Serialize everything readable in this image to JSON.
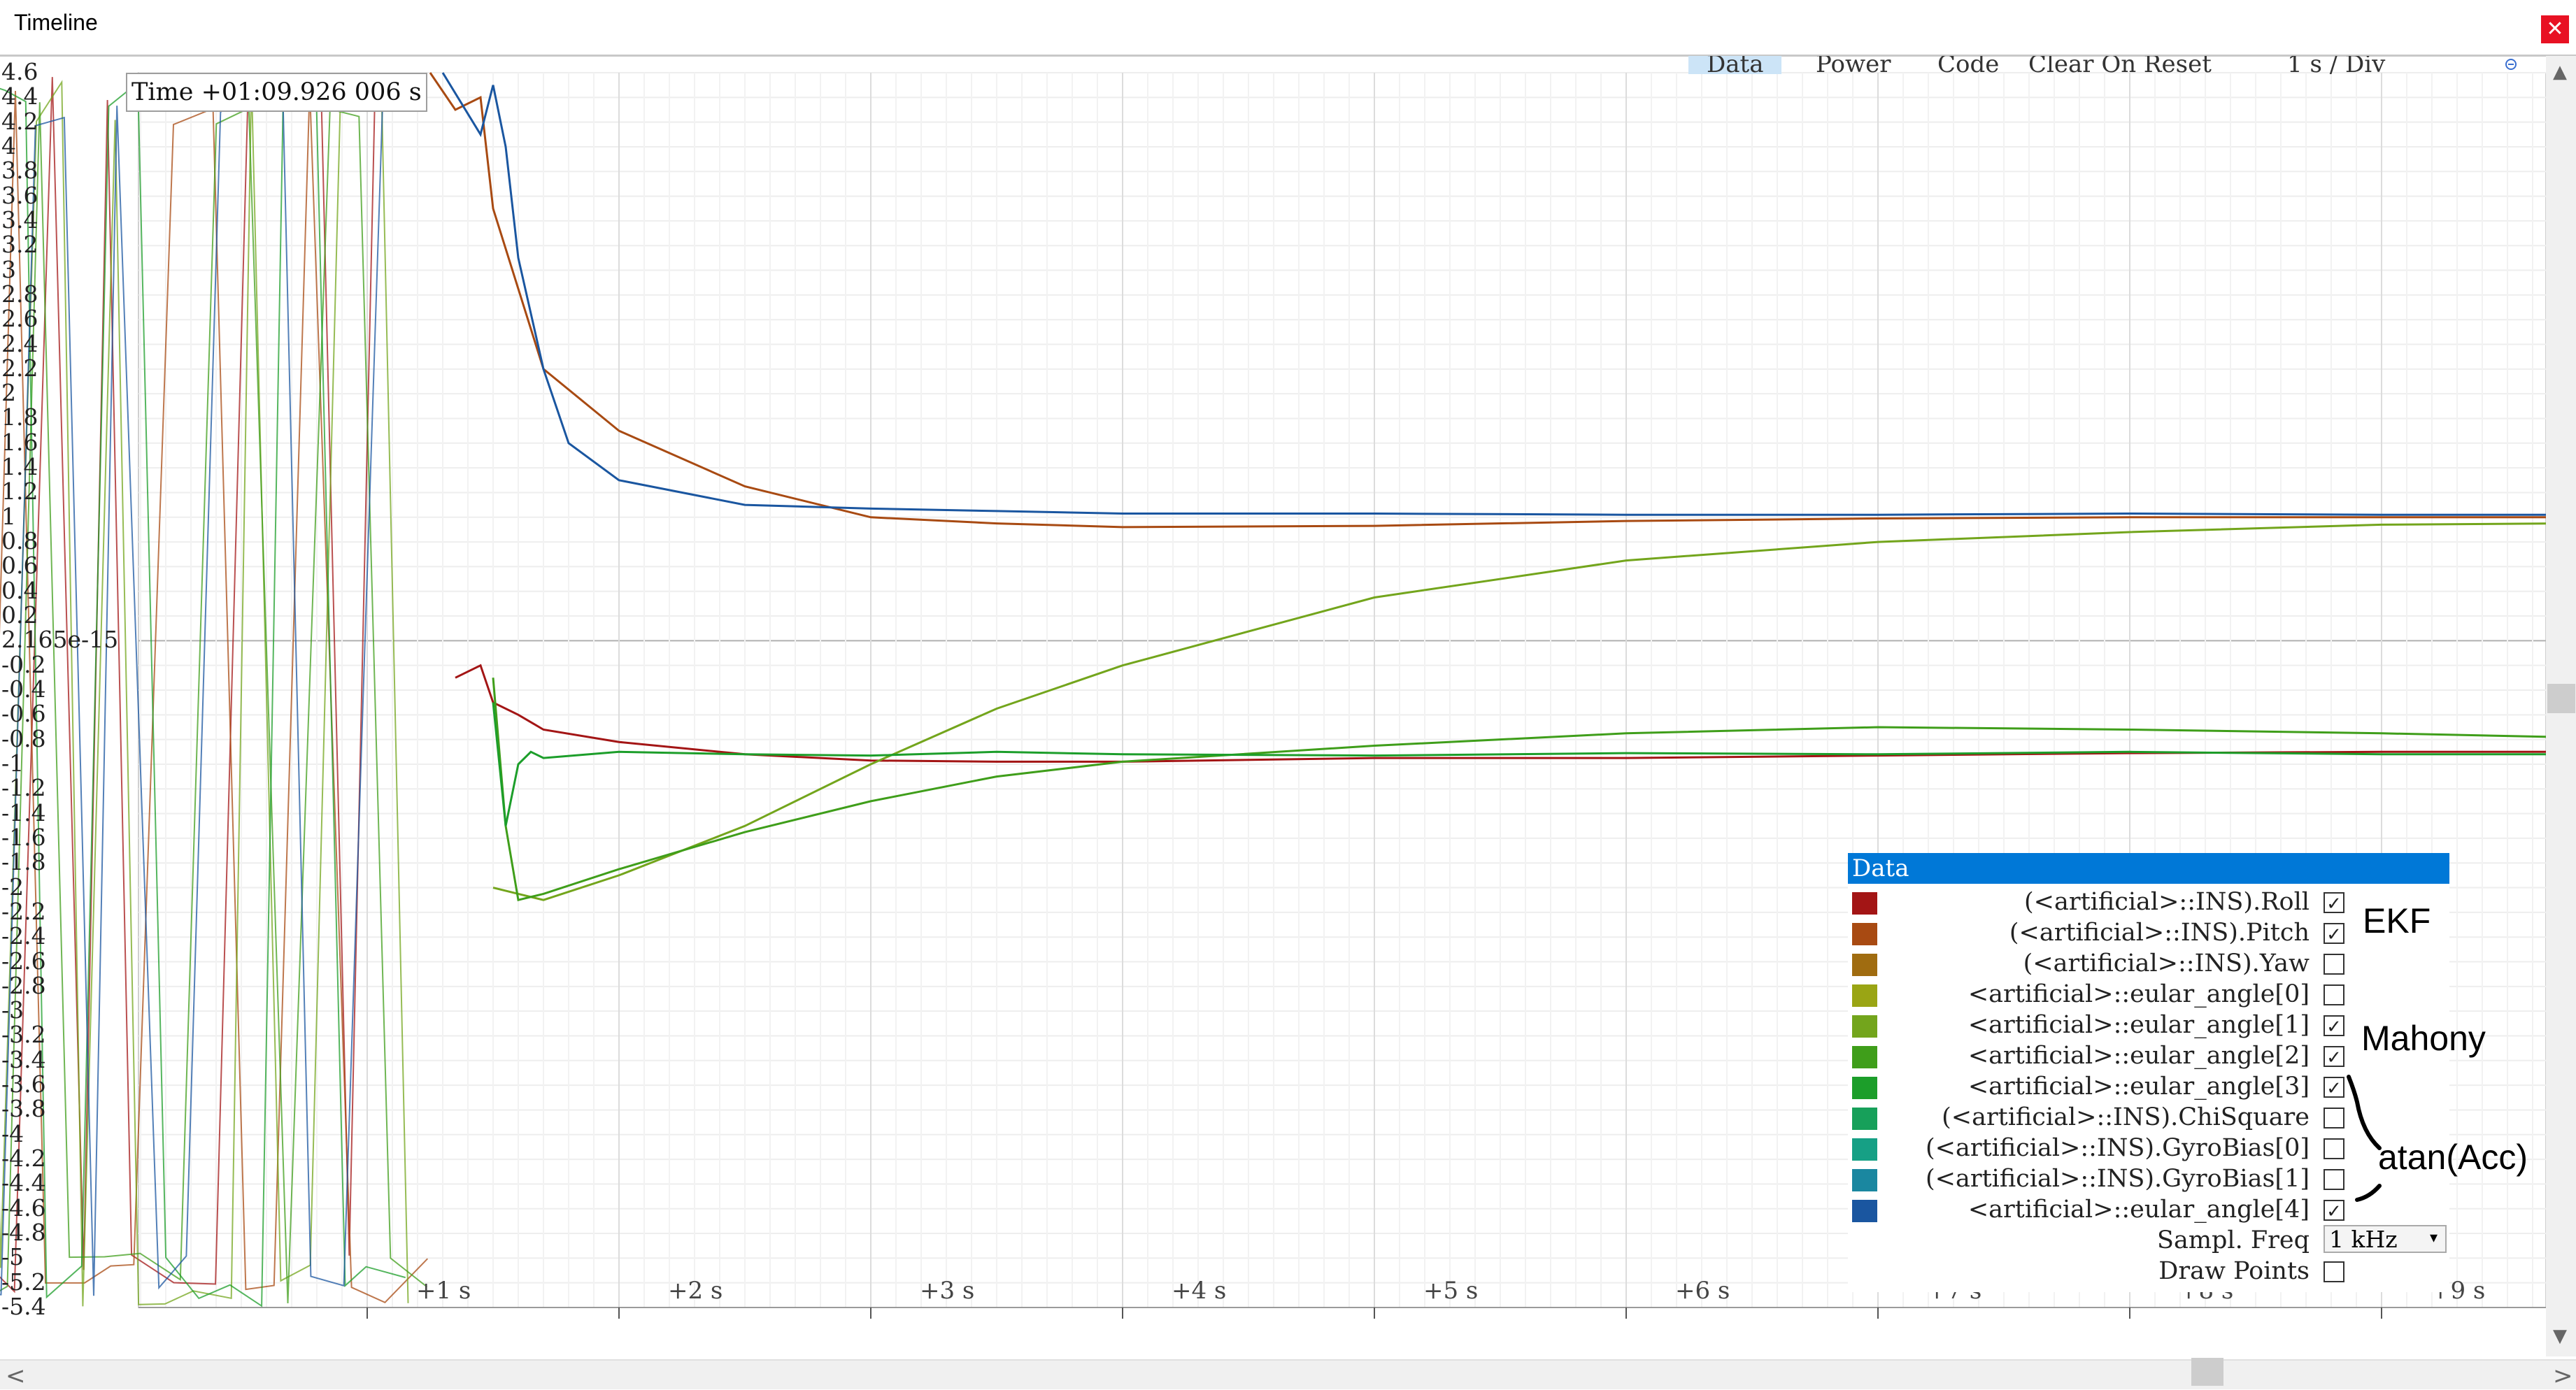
{
  "window": {
    "title": "Timeline",
    "close_glyph": "✕"
  },
  "toolbar": {
    "tabs": [
      {
        "label": "Data",
        "active": true
      },
      {
        "label": "Power",
        "active": false
      },
      {
        "label": "Code",
        "active": false
      }
    ],
    "reset_select": {
      "selected": "Clear On Reset",
      "arrow": "▾"
    },
    "timebase_select": {
      "selected": "1 s / Div",
      "arrow": "▾"
    },
    "zoom_out_icon": "zoom-out-icon",
    "zoom_in_icon": "zoom-in-icon"
  },
  "time_readout": "Time +01:09.926 006 s",
  "y_ticks": [
    "4.6",
    "4.4",
    "4.2",
    "4",
    "3.8",
    "3.6",
    "3.4",
    "3.2",
    "3",
    "2.8",
    "2.6",
    "2.4",
    "2.2",
    "2",
    "1.8",
    "1.6",
    "1.4",
    "1.2",
    "1",
    "0.8",
    "0.6",
    "0.4",
    "0.2",
    "2.165e-15",
    "-0.2",
    "-0.4",
    "-0.6",
    "-0.8",
    "-1",
    "-1.2",
    "-1.4",
    "-1.6",
    "-1.8",
    "-2",
    "-2.2",
    "-2.4",
    "-2.6",
    "-2.8",
    "-3",
    "-3.2",
    "-3.4",
    "-3.6",
    "-3.8",
    "-4",
    "-4.2",
    "-4.4",
    "-4.6",
    "-4.8",
    "-5",
    "-5.2",
    "-5.4"
  ],
  "x_ticks": [
    "+1 s",
    "+2 s",
    "+3 s",
    "+4 s",
    "+5 s",
    "+6 s",
    "+7 s",
    "+8 s",
    "+9 s"
  ],
  "legend": {
    "header": "Data",
    "items": [
      {
        "label": "(<artificial>::INS).Roll",
        "color": "#a31515",
        "checked": true
      },
      {
        "label": "(<artificial>::INS).Pitch",
        "color": "#a84a12",
        "checked": true
      },
      {
        "label": "(<artificial>::INS).Yaw",
        "color": "#a06c10",
        "checked": false
      },
      {
        "label": "<artificial>::eular_angle[0]",
        "color": "#9aa514",
        "checked": false
      },
      {
        "label": "<artificial>::eular_angle[1]",
        "color": "#73a51c",
        "checked": true
      },
      {
        "label": "<artificial>::eular_angle[2]",
        "color": "#3f9e1a",
        "checked": true
      },
      {
        "label": "<artificial>::eular_angle[3]",
        "color": "#1c9e2a",
        "checked": true
      },
      {
        "label": "(<artificial>::INS).ChiSquare",
        "color": "#17a05a",
        "checked": false
      },
      {
        "label": "(<artificial>::INS).GyroBias[0]",
        "color": "#16a085",
        "checked": false
      },
      {
        "label": "(<artificial>::INS).GyroBias[1]",
        "color": "#1a87a0",
        "checked": false
      },
      {
        "label": "<artificial>::eular_angle[4]",
        "color": "#1a56a0",
        "checked": true
      }
    ],
    "check_glyph": "✓",
    "sample_freq_label": "Sampl. Freq",
    "sample_freq_value": "1 kHz",
    "select_arrow": "▾",
    "draw_points_label": "Draw Points",
    "draw_points_checked": false
  },
  "annotations": [
    "EKF",
    "Mahony",
    "atan(Acc)"
  ],
  "scrollbar_arrows": {
    "left": "<",
    "right": ">",
    "up": "▲",
    "down": "▼"
  },
  "chart_data": {
    "type": "line",
    "xlabel": "",
    "ylabel": "",
    "xlim": [
      -0.85,
      9.7
    ],
    "ylim": [
      -5.4,
      4.6
    ],
    "grid": true,
    "legend_position": "bottom-right",
    "series": [
      {
        "name": "(<artificial>::INS).Roll",
        "color": "#a31515",
        "x": [
          1.35,
          1.45,
          1.5,
          1.6,
          1.7,
          2.0,
          2.5,
          3.0,
          3.5,
          4.0,
          5.0,
          6.0,
          7.0,
          8.0,
          9.0,
          9.7
        ],
        "y": [
          -0.3,
          -0.2,
          -0.5,
          -0.6,
          -0.72,
          -0.82,
          -0.92,
          -0.97,
          -0.98,
          -0.98,
          -0.95,
          -0.95,
          -0.93,
          -0.91,
          -0.9,
          -0.9
        ]
      },
      {
        "name": "(<artificial>::INS).Pitch",
        "color": "#a84a12",
        "x": [
          1.25,
          1.35,
          1.45,
          1.5,
          1.7,
          2.0,
          2.5,
          3.0,
          3.5,
          4.0,
          5.0,
          6.0,
          7.0,
          8.0,
          9.0,
          9.7
        ],
        "y": [
          4.6,
          4.3,
          4.4,
          3.5,
          2.2,
          1.7,
          1.25,
          1.0,
          0.95,
          0.92,
          0.93,
          0.97,
          0.99,
          1.0,
          1.0,
          1.0
        ]
      },
      {
        "name": "<artificial>::eular_angle[1]",
        "color": "#73a51c",
        "x": [
          1.5,
          1.6,
          1.7,
          2.0,
          2.5,
          3.0,
          3.5,
          4.0,
          5.0,
          6.0,
          7.0,
          8.0,
          9.0,
          9.7
        ],
        "y": [
          -2.0,
          -2.05,
          -2.1,
          -1.9,
          -1.5,
          -1.0,
          -0.55,
          -0.2,
          0.35,
          0.65,
          0.8,
          0.88,
          0.94,
          0.95
        ]
      },
      {
        "name": "<artificial>::eular_angle[2]",
        "color": "#3f9e1a",
        "x": [
          1.5,
          1.55,
          1.6,
          1.7,
          2.0,
          2.5,
          3.0,
          3.5,
          4.0,
          5.0,
          6.0,
          7.0,
          8.0,
          9.0,
          9.7
        ],
        "y": [
          -0.3,
          -1.5,
          -2.1,
          -2.05,
          -1.85,
          -1.55,
          -1.3,
          -1.1,
          -0.98,
          -0.85,
          -0.75,
          -0.7,
          -0.72,
          -0.75,
          -0.78
        ]
      },
      {
        "name": "<artificial>::eular_angle[3]",
        "color": "#1c9e2a",
        "x": [
          1.5,
          1.55,
          1.6,
          1.65,
          1.7,
          2.0,
          2.5,
          3.0,
          3.5,
          4.0,
          5.0,
          6.0,
          7.0,
          8.0,
          9.0,
          9.7
        ],
        "y": [
          -0.5,
          -1.5,
          -1.0,
          -0.9,
          -0.95,
          -0.9,
          -0.92,
          -0.93,
          -0.9,
          -0.92,
          -0.93,
          -0.91,
          -0.92,
          -0.9,
          -0.92,
          -0.92
        ]
      },
      {
        "name": "<artificial>::eular_angle[4]",
        "color": "#1a56a0",
        "x": [
          1.3,
          1.45,
          1.5,
          1.55,
          1.6,
          1.7,
          1.8,
          2.0,
          2.5,
          3.0,
          3.5,
          4.0,
          5.0,
          6.0,
          7.0,
          8.0,
          9.0,
          9.7
        ],
        "y": [
          4.6,
          4.1,
          4.5,
          4.0,
          3.1,
          2.2,
          1.6,
          1.3,
          1.1,
          1.07,
          1.05,
          1.03,
          1.03,
          1.02,
          1.02,
          1.03,
          1.02,
          1.02
        ]
      }
    ]
  }
}
